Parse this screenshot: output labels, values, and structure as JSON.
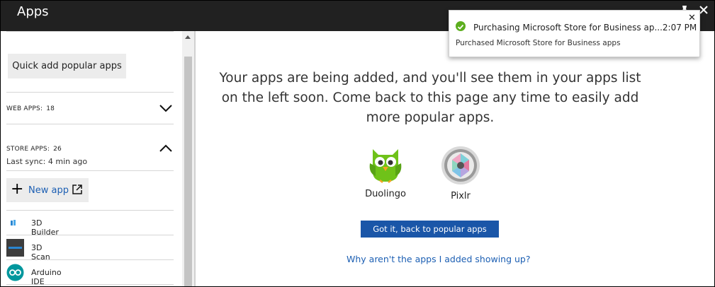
{
  "window": {
    "title": "Apps"
  },
  "sidebar": {
    "quick_add_label": "Quick add popular apps",
    "web_apps": {
      "label": "WEB APPS:",
      "count": "18"
    },
    "store_apps": {
      "label": "STORE APPS:",
      "count": "26",
      "sync": "Last sync: 4 min ago"
    },
    "new_app_label": "New app",
    "apps": [
      {
        "name": "3D Builder",
        "icon": "3d-builder-icon"
      },
      {
        "name": "3D Scan",
        "icon": "3d-scan-icon"
      },
      {
        "name": "Arduino IDE",
        "icon": "arduino-icon"
      }
    ]
  },
  "main": {
    "message": "Your apps are being added, and you'll see them in your apps list on the left soon. Come back to this page any time to easily add more popular apps.",
    "apps": [
      {
        "name": "Duolingo",
        "icon": "duolingo-owl-icon"
      },
      {
        "name": "Pixlr",
        "icon": "pixlr-icon"
      }
    ],
    "got_it_label": "Got it, back to popular apps",
    "why_link": "Why aren't the apps I added showing up?"
  },
  "notification": {
    "title": "Purchasing Microsoft Store for Business ap...",
    "time": "2:07 PM",
    "body": "Purchased Microsoft Store for Business apps",
    "status_color": "#5cae1e"
  },
  "colors": {
    "accent": "#1a56a8",
    "link": "#1c5fb3",
    "titlebar": "#212121"
  }
}
